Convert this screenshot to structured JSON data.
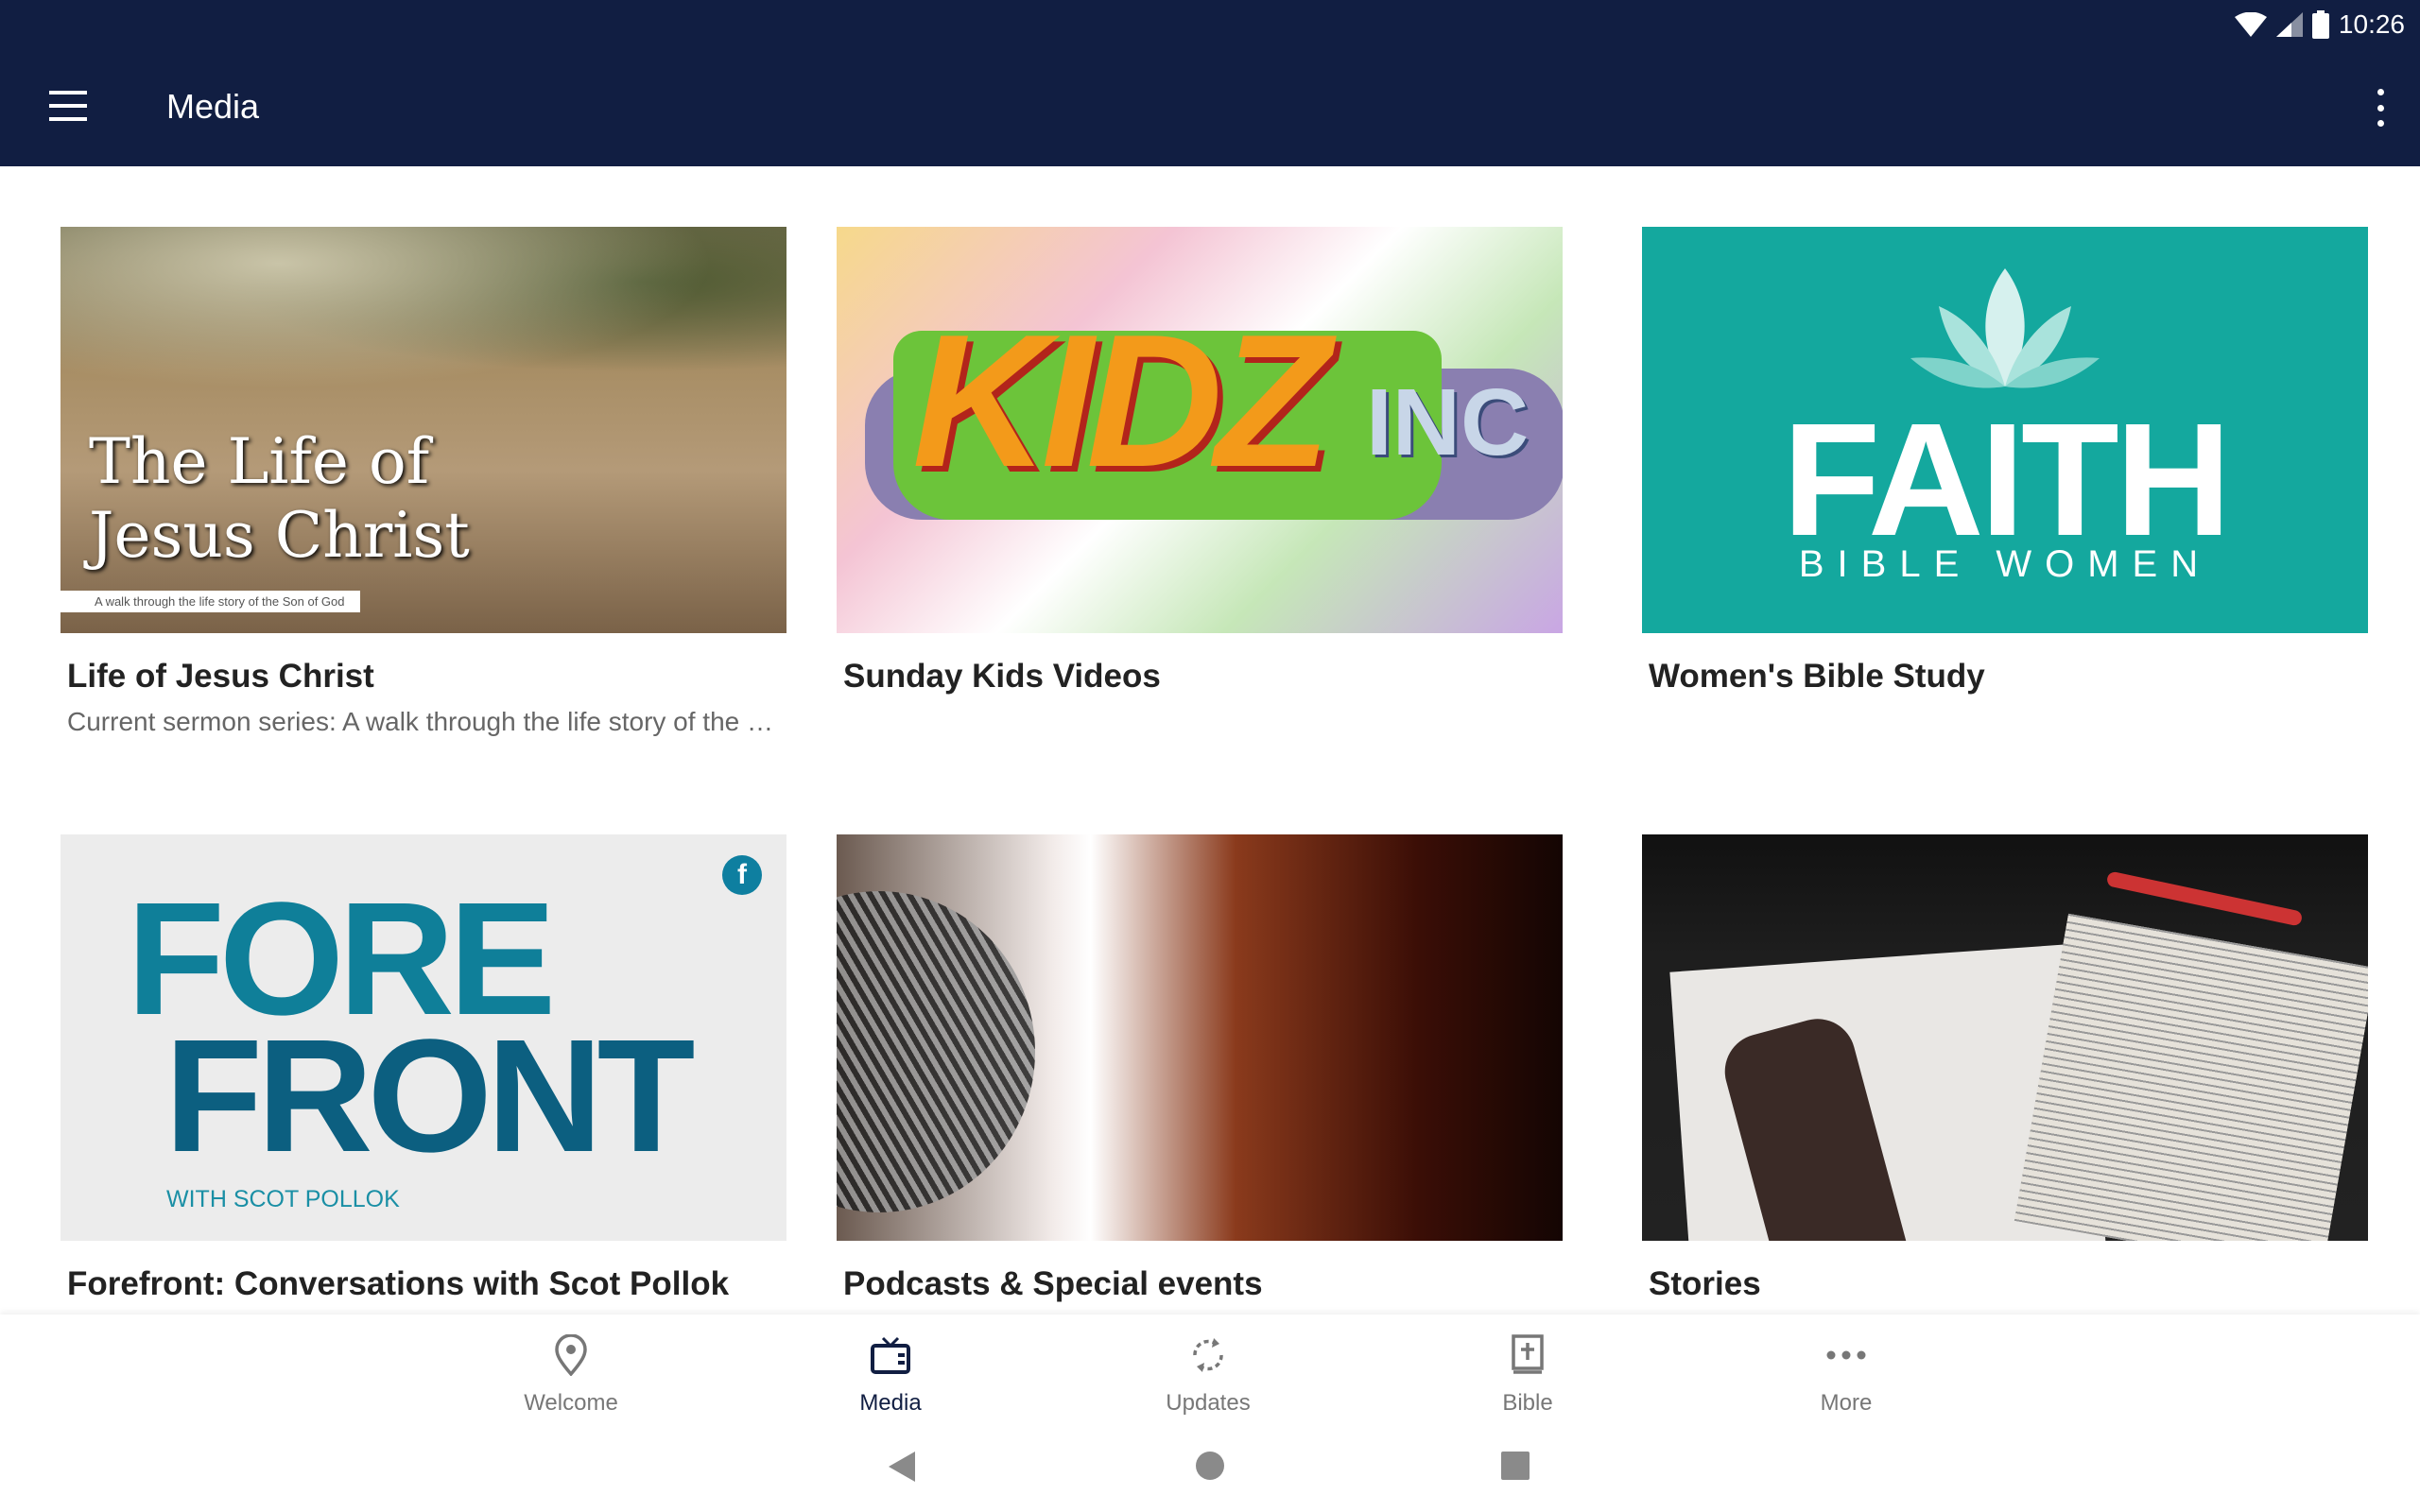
{
  "status_bar": {
    "time": "10:26",
    "icons": [
      "wifi-icon",
      "signal-icon",
      "battery-icon"
    ]
  },
  "app_bar": {
    "title": "Media",
    "menu_icon": "hamburger-icon",
    "overflow_icon": "more-vert-icon"
  },
  "colors": {
    "app_bar": "#111e42",
    "active_tab": "#111e42",
    "inactive_tab": "#777777",
    "faith_teal": "#14a89e"
  },
  "cards": [
    {
      "title": "Life of Jesus Christ",
      "subtitle": "Current sermon series: A walk through the life story of the S...",
      "image_text": [
        "The Life of",
        "Jesus Christ",
        "A walk through the life story of the Son of God"
      ]
    },
    {
      "title": "Sunday Kids Videos",
      "subtitle": "",
      "image_text": [
        "KIDZ",
        "INC"
      ]
    },
    {
      "title": "Women's Bible Study",
      "subtitle": "",
      "image_text": [
        "FAITH",
        "BIBLE WOMEN"
      ]
    },
    {
      "title": "Forefront: Conversations with Scot Pollok",
      "subtitle": "",
      "image_text": [
        "FORE",
        "FRONT",
        "WITH SCOT POLLOK"
      ]
    },
    {
      "title": "Podcasts & Special events",
      "subtitle": "",
      "image_text": []
    },
    {
      "title": "Stories",
      "subtitle": "",
      "image_text": []
    }
  ],
  "bottom_nav": [
    {
      "label": "Welcome",
      "icon": "location-pin-icon",
      "active": false
    },
    {
      "label": "Media",
      "icon": "tv-icon",
      "active": true
    },
    {
      "label": "Updates",
      "icon": "refresh-icon",
      "active": false
    },
    {
      "label": "Bible",
      "icon": "bible-icon",
      "active": false
    },
    {
      "label": "More",
      "icon": "more-horiz-icon",
      "active": false
    }
  ],
  "system_nav": [
    "back-icon",
    "home-icon",
    "recents-icon"
  ]
}
